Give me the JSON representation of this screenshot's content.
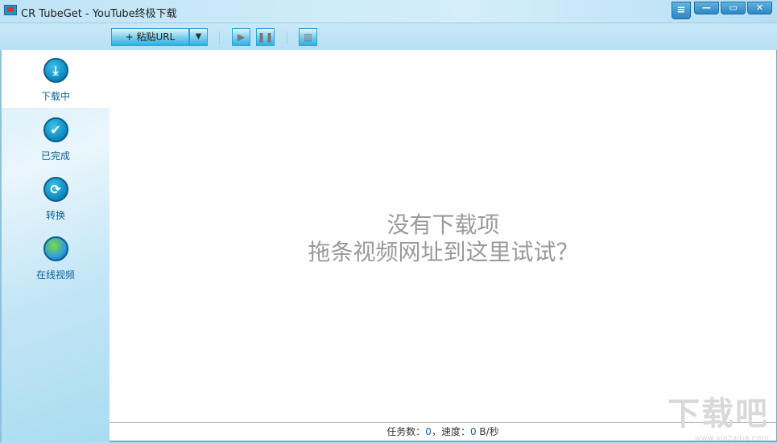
{
  "window": {
    "title": "CR TubeGet - YouTube终极下载",
    "menu_icon": "menu-icon",
    "min_icon": "minimize-icon",
    "max_icon": "maximize-icon",
    "close_icon": "close-icon"
  },
  "toolbar": {
    "paste_label": "+ 粘贴URL",
    "dropdown_icon": "▼",
    "up_icon": "↑",
    "play_icon": "▶",
    "pause_icon": "❚❚",
    "down_icon": "↓",
    "delete_icon": "🗑"
  },
  "sidebar": {
    "items": [
      {
        "label": "下载中",
        "icon": "download-icon",
        "active": true
      },
      {
        "label": "已完成",
        "icon": "check-icon"
      },
      {
        "label": "转换",
        "icon": "convert-icon"
      },
      {
        "label": "在线视频",
        "icon": "globe-icon"
      }
    ]
  },
  "main": {
    "empty_title": "没有下载项",
    "empty_hint": "拖条视频网址到这里试试？"
  },
  "status": {
    "tasks_label": "任务数：",
    "tasks": "0",
    "sep": "，",
    "speed_label": "速度：",
    "speed": "0",
    "speed_unit": " B/秒"
  },
  "watermark": {
    "logo": "下载吧",
    "url": "www.xiazaiba.com"
  }
}
